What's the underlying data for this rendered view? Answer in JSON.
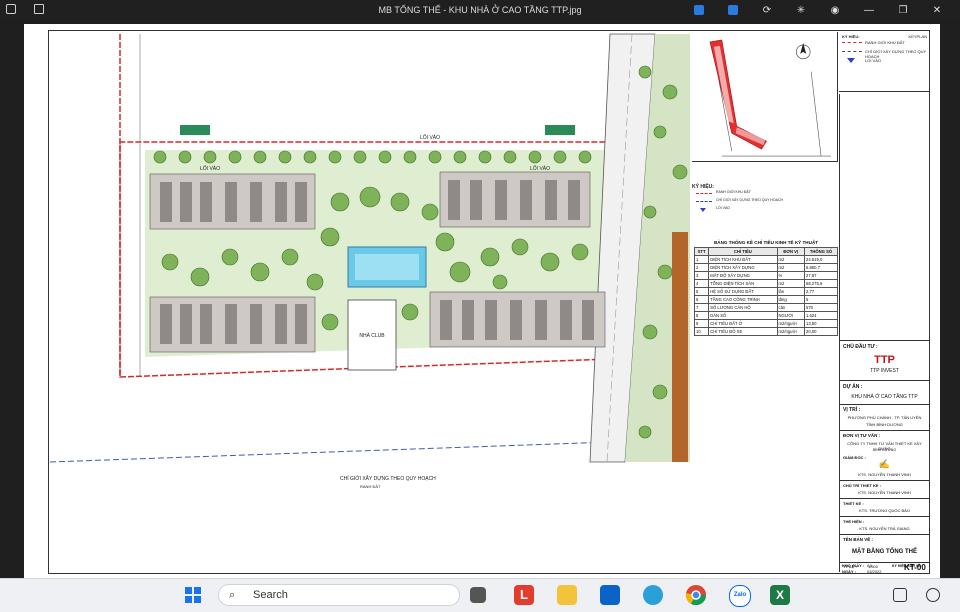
{
  "window": {
    "title": "MB TỔNG THỂ - KHU NHÀ Ở CAO TẦNG TTP.jpg"
  },
  "drawing": {
    "plan": {
      "loi_vao_top": "LỐI VÀO",
      "loi_vao_left": "LỐI VÀO",
      "loi_vao_right": "LỐI VÀO",
      "club": "NHÀ CLUB",
      "boundary_note": "CHỈ GIỚI XÂY DỰNG THEO QUY HOẠCH",
      "boundary_note2": "RANH ĐẤT"
    },
    "keyplan_label": "KEYPLAN",
    "legend_header": "KÝ HIỆU:",
    "legend": [
      {
        "label": "RANH GIỚI KHU ĐẤT",
        "color": "#d12b2b"
      },
      {
        "label": "CHỈ GIỚI XÂY DỰNG THEO QUY HOẠCH",
        "color": "#2b3fd1"
      },
      {
        "label": "LỐI VÀO",
        "color": "#2b3fd1"
      }
    ],
    "kyhieu_title": "KÝ HIỆU:",
    "kyhieu_items": [
      "RANH GIỚI KHU ĐẤT",
      "CHỈ GIỚI XÂY DỰNG THEO QUY HOẠCH",
      "LỐI VÀO"
    ],
    "stats_title": "BẢNG THỐNG KÊ CHỈ TIÊU KINH TẾ KỸ THUẬT",
    "stats_headers": [
      "STT",
      "CHỈ TIÊU",
      "ĐƠN VỊ",
      "THÔNG SỐ"
    ],
    "stats_rows": [
      [
        "1",
        "DIỆN TÍCH KHU ĐẤT",
        "m2",
        "24.619,0"
      ],
      [
        "2",
        "DIỆN TÍCH XÂY DỰNG",
        "m2",
        "6.860,7"
      ],
      [
        "3",
        "MẬT ĐỘ XÂY DỰNG",
        "%",
        "27,87"
      ],
      [
        "4",
        "TỔNG DIỆN TÍCH SÀN",
        "m2",
        "68.275,6"
      ],
      [
        "5",
        "HỆ SỐ SỬ DỤNG ĐẤT",
        "lần",
        "2,77"
      ],
      [
        "6",
        "TẦNG CAO CÔNG TRÌNH",
        "tầng",
        "5"
      ],
      [
        "7",
        "SỐ LƯỢNG CĂN HỘ",
        "căn",
        "570"
      ],
      [
        "8",
        "DÂN SỐ",
        "NGƯỜI",
        "1.624"
      ],
      [
        "9",
        "CHỈ TIÊU ĐẤT Ở",
        "m2/người",
        "13,50"
      ],
      [
        "10",
        "CHỈ TIÊU ĐỖ XE",
        "m2/người",
        "20,00"
      ]
    ],
    "title_block": {
      "chu_dau_tu_label": "CHỦ ĐẦU TƯ :",
      "logo": "TTP",
      "logo_sub": "TTP INVEST",
      "du_an_label": "DỰ ÁN :",
      "du_an": "KHU NHÀ Ở CAO TẦNG TTP",
      "vi_tri_label": "VỊ TRÍ :",
      "vi_tri_1": "PHƯỜNG PHÚ CHÁNH - TP. TÂN UYÊN",
      "vi_tri_2": "TỈNH BÌNH DƯƠNG",
      "don_vi_label": "ĐƠN VỊ TƯ VẤN :",
      "don_vi": "CÔNG TY TNHH TƯ VẤN THIẾT KẾ XÂY DỰNG",
      "don_vi_2": "BÌNH DƯƠNG",
      "giam_doc_label": "GIÁM ĐỐC :",
      "giam_doc": "KTS. NGUYỄN THANH VINH",
      "chu_tri_label": "CHỦ TRÌ THIẾT KẾ :",
      "chu_tri": "KTS. NGUYỄN THANH VINH",
      "thiet_ke_label": "THIẾT KẾ :",
      "thiet_ke": "KTS. TRƯƠNG QUỐC BẢO",
      "thuc_hien_label": "THỂ HIỆN :",
      "thuc_hien": "KTS. NGUYỄN TRÀ GIANG",
      "ten_ban_ve_label": "TÊN BẢN VẼ :",
      "ten_ban_ve": "MẶT BẰNG TỔNG THỂ",
      "ty_le_label": "TỶ LỆ :",
      "ty_le": "1/500",
      "kho_giay_label": "KHỔ GIẤY :",
      "kho_giay": "A3",
      "ngay_label": "NGÀY :",
      "ngay": "03/2022",
      "ky_hieu_label": "KÝ HIỆU BẢN VẼ :",
      "ky_hieu": "KT-00"
    }
  },
  "taskbar": {
    "search_placeholder": "Search",
    "icons": [
      "windows-start-icon",
      "search-icon",
      "taskview-icon",
      "app-l-icon",
      "file-explorer-icon",
      "outlook-icon",
      "edge-icon",
      "chrome-icon",
      "zalo-icon",
      "excel-icon"
    ],
    "zalo_label": "Zalo"
  }
}
